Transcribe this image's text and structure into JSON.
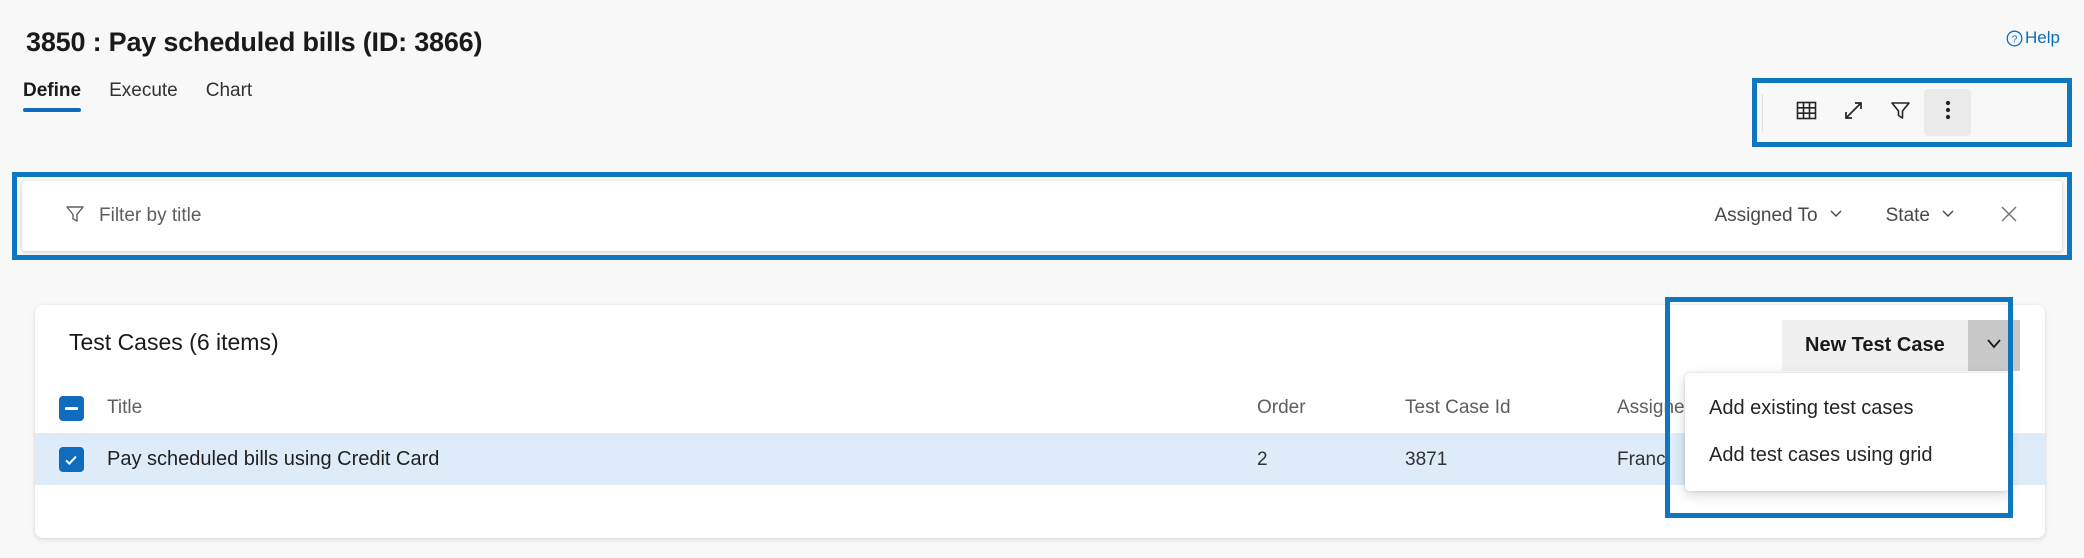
{
  "header": {
    "title": "3850 : Pay scheduled bills (ID: 3866)",
    "help_label": "Help"
  },
  "tabs": [
    {
      "label": "Define",
      "active": true
    },
    {
      "label": "Execute",
      "active": false
    },
    {
      "label": "Chart",
      "active": false
    }
  ],
  "toolbar": {
    "grid_icon": "grid-icon",
    "expand_icon": "expand-icon",
    "filter_icon": "filter-icon",
    "more_icon": "more-options-icon"
  },
  "filter_bar": {
    "placeholder": "Filter by title",
    "value": "",
    "funnel_icon": "filter-funnel-icon",
    "assigned_to_label": "Assigned To",
    "state_label": "State",
    "clear_icon": "close-icon"
  },
  "card": {
    "title": "Test Cases (6 items)",
    "new_test_case_label": "New Test Case",
    "chevron_icon": "chevron-down-icon"
  },
  "dropdown": {
    "items": [
      {
        "label": "Add existing test cases"
      },
      {
        "label": "Add test cases using grid"
      }
    ]
  },
  "table": {
    "columns": {
      "title": "Title",
      "order": "Order",
      "test_case_id": "Test Case Id",
      "assigned_to": "Assigned"
    },
    "rows": [
      {
        "checked": true,
        "title": "Pay scheduled bills using Credit Card",
        "order": "2",
        "test_case_id": "3871",
        "assigned_to": "Franc"
      }
    ]
  },
  "colors": {
    "accent": "#0f6cbd",
    "highlight_box": "#0f76c0",
    "selected_row": "#deecf9",
    "page_bg": "#f8f8f8"
  }
}
